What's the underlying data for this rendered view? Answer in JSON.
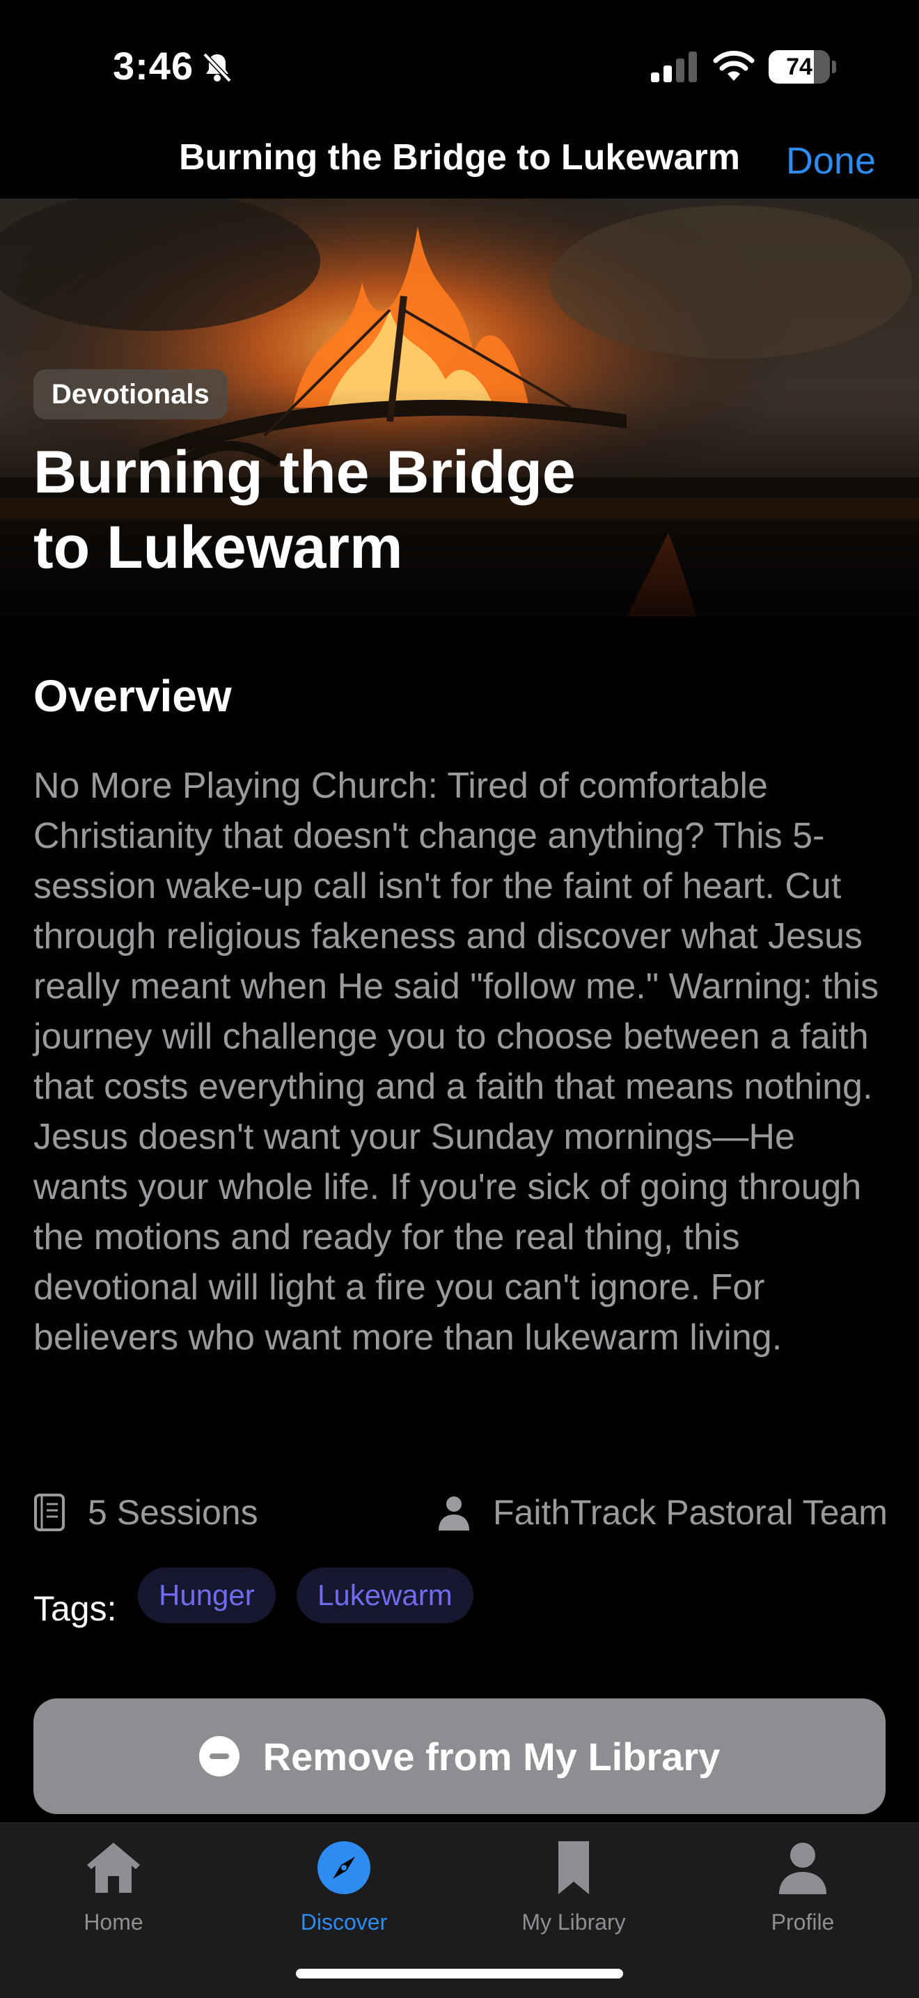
{
  "status_bar": {
    "time": "3:46",
    "battery_percent": "74",
    "battery_level": 0.74,
    "icons": [
      "bell-slash-icon",
      "cellular-signal-icon",
      "wifi-icon",
      "battery-icon"
    ]
  },
  "nav": {
    "title": "Burning the Bridge to Lukewarm",
    "done_label": "Done"
  },
  "hero": {
    "category": "Devotionals",
    "title_line1": "Burning the Bridge",
    "title_line2": "to Lukewarm"
  },
  "overview": {
    "heading": "Overview",
    "body": "No More Playing Church: Tired of comfortable Christianity that doesn't change anything? This 5-session wake-up call isn't for the faint of heart. Cut through religious fakeness and discover what Jesus really meant when He said \"follow me.\" Warning: this journey will challenge you to choose between a faith that costs everything and a faith that means nothing. Jesus doesn't want your Sunday mornings—He wants your whole life. If you're sick of going through the motions and ready for the real thing, this devotional will light a fire you can't ignore. For believers who want more than lukewarm living."
  },
  "meta": {
    "sessions": "5 Sessions",
    "author": "FaithTrack Pastoral Team"
  },
  "tags": {
    "label": "Tags:",
    "items": [
      "Hunger",
      "Lukewarm"
    ]
  },
  "remove_button": {
    "label": "Remove from My Library"
  },
  "tab_bar": {
    "items": [
      {
        "label": "Home",
        "icon": "house-icon"
      },
      {
        "label": "Discover",
        "icon": "compass-icon",
        "active": true
      },
      {
        "label": "My Library",
        "icon": "bookmark-icon"
      },
      {
        "label": "Profile",
        "icon": "person-icon"
      }
    ]
  },
  "colors": {
    "accent": "#2e8cf0",
    "tag_text": "#6f6cf0",
    "tag_background": "#16172e",
    "button_background": "#8d8d92"
  }
}
